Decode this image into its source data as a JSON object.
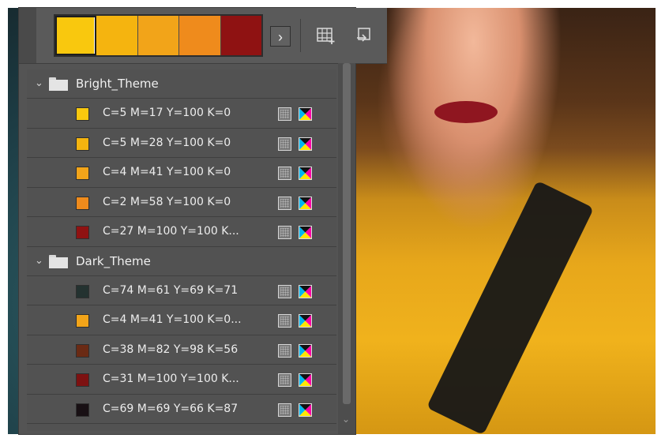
{
  "toolbar": {
    "swatches": [
      "#f9c80e",
      "#f5b40f",
      "#f2a419",
      "#ef8b1c",
      "#8f1212"
    ],
    "more_glyph": "›"
  },
  "groups": [
    {
      "name": "Bright_Theme",
      "items": [
        {
          "label": "C=5 M=17 Y=100 K=0",
          "color": "#f9c80e"
        },
        {
          "label": "C=5 M=28 Y=100 K=0",
          "color": "#f5b40f"
        },
        {
          "label": "C=4 M=41 Y=100 K=0",
          "color": "#f2a419"
        },
        {
          "label": "C=2 M=58 Y=100 K=0",
          "color": "#ef8b1c"
        },
        {
          "label": "C=27 M=100 Y=100 K...",
          "color": "#8f1212"
        }
      ]
    },
    {
      "name": "Dark_Theme",
      "items": [
        {
          "label": "C=74 M=61 Y=69 K=71",
          "color": "#243230"
        },
        {
          "label": "C=4 M=41 Y=100 K=0...",
          "color": "#f2a419"
        },
        {
          "label": "C=38 M=82 Y=98 K=56",
          "color": "#6a2a14"
        },
        {
          "label": "C=31 M=100 Y=100 K...",
          "color": "#7d1111"
        },
        {
          "label": "C=69 M=69 Y=66 K=87",
          "color": "#181014"
        }
      ]
    }
  ],
  "icons": {
    "collapse": "chevron-down-icon",
    "folder": "folder-icon",
    "global": "grid-icon",
    "mode": "cmyk-icon"
  }
}
